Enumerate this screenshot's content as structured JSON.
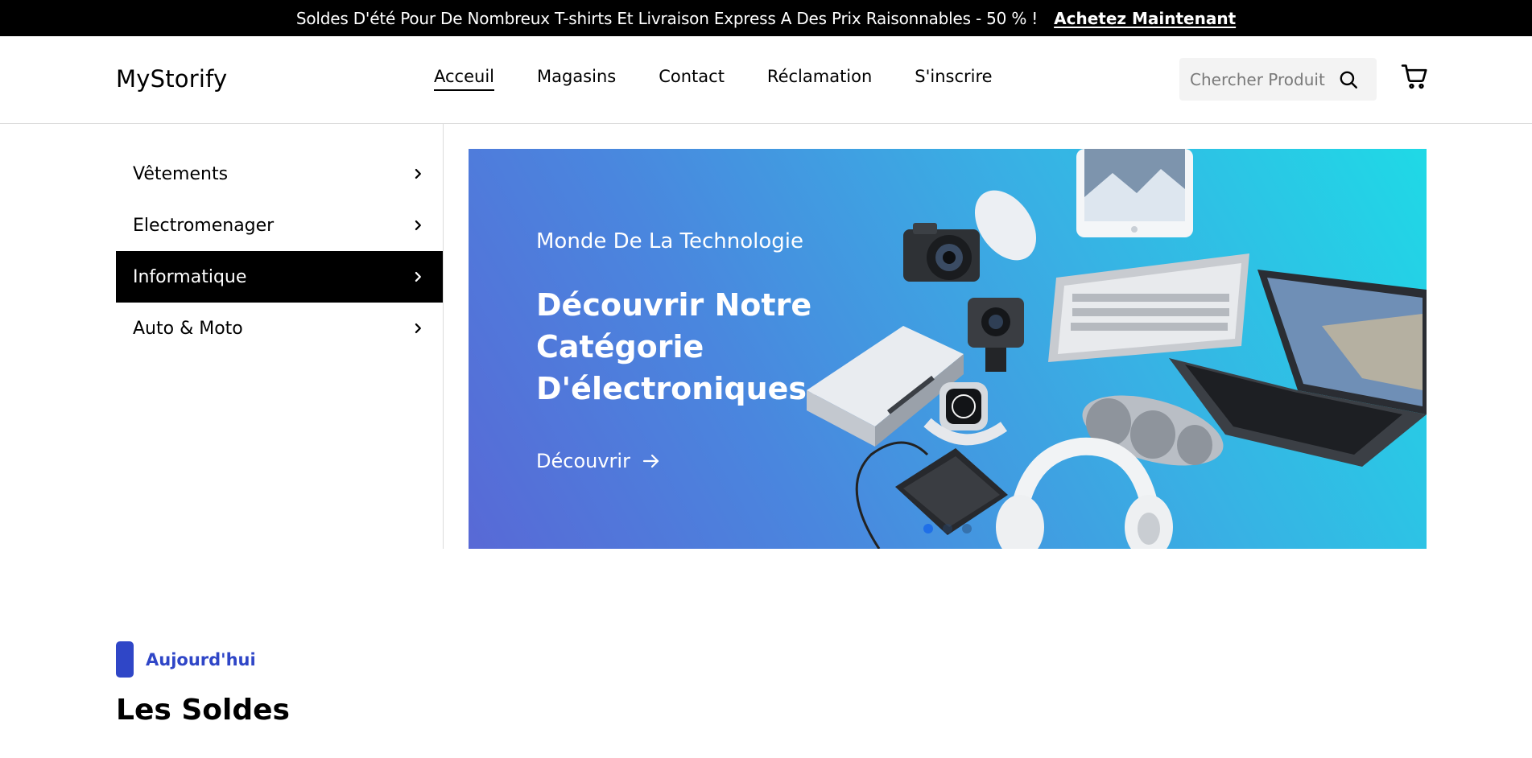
{
  "promo": {
    "text": "Soldes D'été Pour De Nombreux T-shirts Et Livraison Express A Des Prix Raisonnables - 50 % !",
    "link_label": "Achetez Maintenant"
  },
  "header": {
    "logo": "MyStorify",
    "nav": [
      {
        "label": "Acceuil",
        "active": true
      },
      {
        "label": "Magasins"
      },
      {
        "label": "Contact"
      },
      {
        "label": "Réclamation"
      },
      {
        "label": "S'inscrire"
      }
    ],
    "search": {
      "placeholder": "Chercher Produit",
      "value": ""
    }
  },
  "sidebar": {
    "categories": [
      {
        "label": "Vêtements"
      },
      {
        "label": "Electromenager"
      },
      {
        "label": "Informatique",
        "selected": true
      },
      {
        "label": "Auto & Moto"
      }
    ]
  },
  "hero": {
    "kicker": "Monde De La Technologie",
    "title": "Découvrir Notre Catégorie D'électroniques.",
    "cta_label": "Découvrir",
    "slide_count": 3,
    "active_slide": 1,
    "gradient_colors": [
      "#5869d6",
      "#1fd9e6"
    ]
  },
  "section": {
    "tag": "Aujourd'hui",
    "title": "Les Soldes",
    "accent_color": "#2f46c7"
  }
}
